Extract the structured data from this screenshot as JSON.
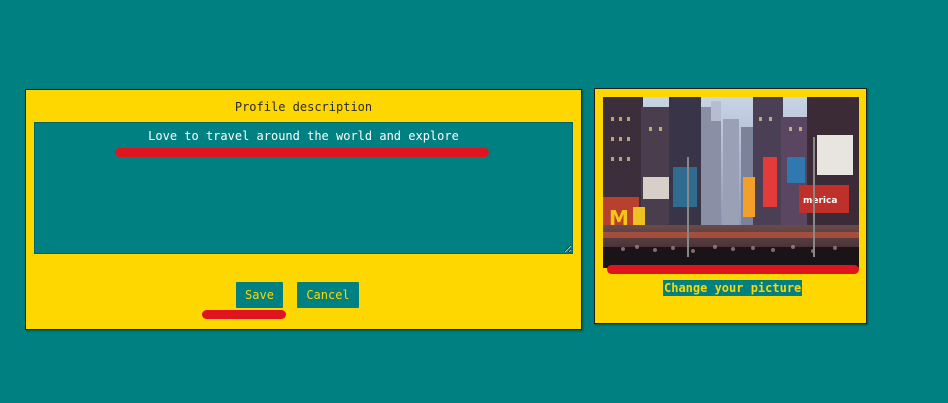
{
  "profile": {
    "title": "Profile description",
    "description_value": "Love to travel around the world and explore",
    "save_label": "Save",
    "cancel_label": "Cancel"
  },
  "picture": {
    "change_label": "Change your picture",
    "image_subject": "times-square-city-photo"
  },
  "colors": {
    "background": "#008080",
    "panel": "#ffd700",
    "button": "#008080",
    "button_text": "#ffd700",
    "annotation_mark": "#e0141e"
  }
}
